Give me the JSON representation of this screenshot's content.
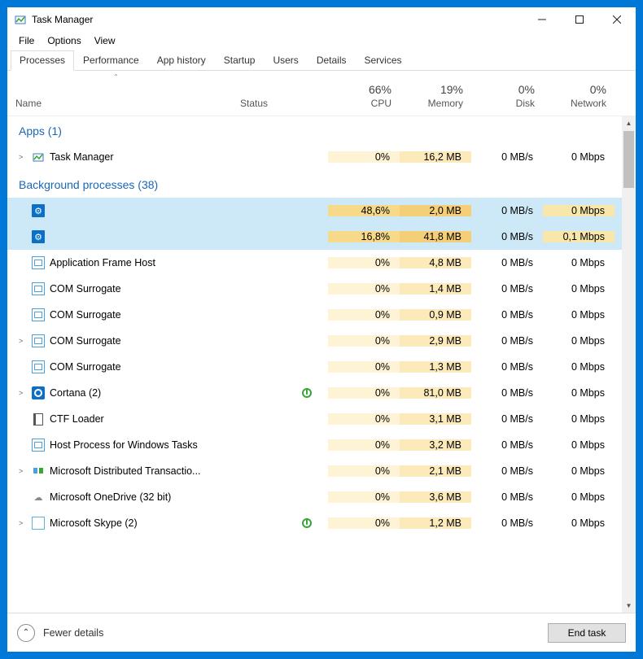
{
  "title": "Task Manager",
  "menus": [
    "File",
    "Options",
    "View"
  ],
  "tabs": [
    "Processes",
    "Performance",
    "App history",
    "Startup",
    "Users",
    "Details",
    "Services"
  ],
  "active_tab": 0,
  "columns": {
    "name": "Name",
    "status": "Status",
    "cpu_pct": "66%",
    "cpu": "CPU",
    "mem_pct": "19%",
    "mem": "Memory",
    "disk_pct": "0%",
    "disk": "Disk",
    "net_pct": "0%",
    "net": "Network"
  },
  "groups": [
    {
      "label": "Apps (1)",
      "rows": [
        {
          "chevron": ">",
          "icon": "taskmgr",
          "name": "Task Manager",
          "status": "",
          "cpu": "0%",
          "mem": "16,2 MB",
          "disk": "0 MB/s",
          "net": "0 Mbps",
          "sel": false
        }
      ]
    },
    {
      "label": "Background processes (38)",
      "rows": [
        {
          "chevron": "",
          "icon": "gear",
          "name": "",
          "status": "",
          "cpu": "48,6%",
          "mem": "2,0 MB",
          "disk": "0 MB/s",
          "net": "0 Mbps",
          "sel": true
        },
        {
          "chevron": "",
          "icon": "gear",
          "name": "",
          "status": "",
          "cpu": "16,8%",
          "mem": "41,8 MB",
          "disk": "0 MB/s",
          "net": "0,1 Mbps",
          "sel": true
        },
        {
          "chevron": "",
          "icon": "win",
          "name": "Application Frame Host",
          "status": "",
          "cpu": "0%",
          "mem": "4,8 MB",
          "disk": "0 MB/s",
          "net": "0 Mbps",
          "sel": false
        },
        {
          "chevron": "",
          "icon": "win",
          "name": "COM Surrogate",
          "status": "",
          "cpu": "0%",
          "mem": "1,4 MB",
          "disk": "0 MB/s",
          "net": "0 Mbps",
          "sel": false
        },
        {
          "chevron": "",
          "icon": "win",
          "name": "COM Surrogate",
          "status": "",
          "cpu": "0%",
          "mem": "0,9 MB",
          "disk": "0 MB/s",
          "net": "0 Mbps",
          "sel": false
        },
        {
          "chevron": ">",
          "icon": "win",
          "name": "COM Surrogate",
          "status": "",
          "cpu": "0%",
          "mem": "2,9 MB",
          "disk": "0 MB/s",
          "net": "0 Mbps",
          "sel": false
        },
        {
          "chevron": "",
          "icon": "win",
          "name": "COM Surrogate",
          "status": "",
          "cpu": "0%",
          "mem": "1,3 MB",
          "disk": "0 MB/s",
          "net": "0 Mbps",
          "sel": false
        },
        {
          "chevron": ">",
          "icon": "cortana",
          "name": "Cortana (2)",
          "status": "verify",
          "cpu": "0%",
          "mem": "81,0 MB",
          "disk": "0 MB/s",
          "net": "0 Mbps",
          "sel": false
        },
        {
          "chevron": "",
          "icon": "ctf",
          "name": "CTF Loader",
          "status": "",
          "cpu": "0%",
          "mem": "3,1 MB",
          "disk": "0 MB/s",
          "net": "0 Mbps",
          "sel": false
        },
        {
          "chevron": "",
          "icon": "win",
          "name": "Host Process for Windows Tasks",
          "status": "",
          "cpu": "0%",
          "mem": "3,2 MB",
          "disk": "0 MB/s",
          "net": "0 Mbps",
          "sel": false
        },
        {
          "chevron": ">",
          "icon": "msdtc",
          "name": "Microsoft Distributed Transactio...",
          "status": "",
          "cpu": "0%",
          "mem": "2,1 MB",
          "disk": "0 MB/s",
          "net": "0 Mbps",
          "sel": false
        },
        {
          "chevron": "",
          "icon": "cloud",
          "name": "Microsoft OneDrive (32 bit)",
          "status": "",
          "cpu": "0%",
          "mem": "3,6 MB",
          "disk": "0 MB/s",
          "net": "0 Mbps",
          "sel": false
        },
        {
          "chevron": ">",
          "icon": "skype",
          "name": "Microsoft Skype (2)",
          "status": "verify",
          "cpu": "0%",
          "mem": "1,2 MB",
          "disk": "0 MB/s",
          "net": "0 Mbps",
          "sel": false
        }
      ]
    }
  ],
  "footer": {
    "fewer": "Fewer details",
    "end": "End task"
  }
}
